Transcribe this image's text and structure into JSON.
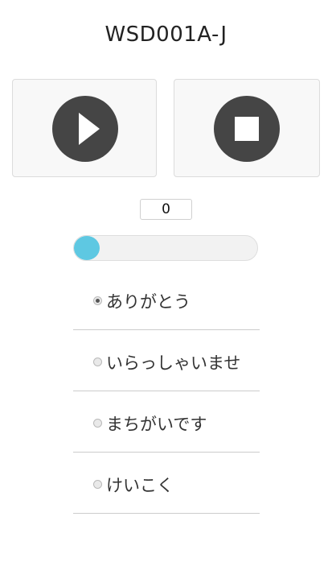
{
  "title": "WSD001A-J",
  "controls": {
    "play_icon": "play-icon",
    "stop_icon": "stop-icon",
    "icon_color": "#454545"
  },
  "counter": {
    "value": "0"
  },
  "slider": {
    "value": 0,
    "min": 0,
    "max": 100,
    "thumb_color": "#5ec8e2"
  },
  "options": [
    {
      "label": "ありがとう",
      "checked": true
    },
    {
      "label": "いらっしゃいませ",
      "checked": false
    },
    {
      "label": "まちがいです",
      "checked": false
    },
    {
      "label": "けいこく",
      "checked": false
    }
  ]
}
